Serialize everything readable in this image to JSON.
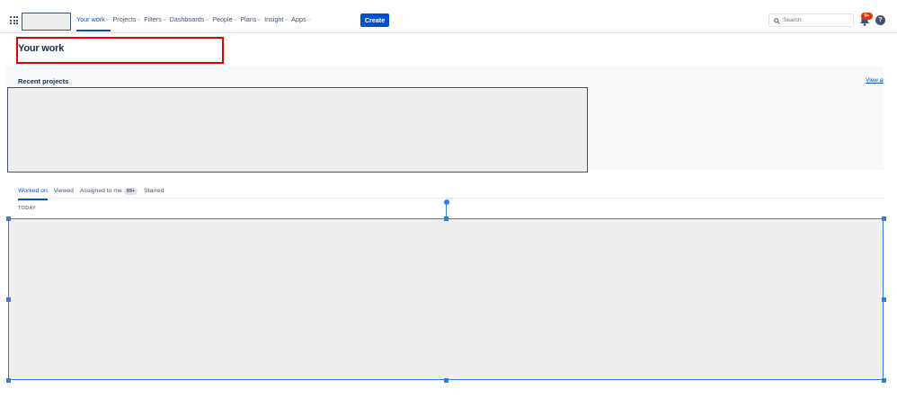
{
  "nav": {
    "your_work": "Your work",
    "projects": "Projects",
    "filters": "Filters",
    "dashboards": "Dashboards",
    "people": "People",
    "plans": "Plans",
    "insight": "Insight",
    "apps": "Apps",
    "create": "Create"
  },
  "search": {
    "placeholder": "Search"
  },
  "notifications": {
    "badge": "9+"
  },
  "help": {
    "label": "?"
  },
  "page": {
    "title": "Your work"
  },
  "recent": {
    "label": "Recent projects",
    "view_all": "View all"
  },
  "tabs": {
    "worked_on": "Worked on",
    "viewed": "Viewed",
    "assigned_to_me": "Assigned to me",
    "assigned_count": "99+",
    "starred": "Starred"
  },
  "list": {
    "group_label": "TODAY"
  },
  "colors": {
    "accent": "#0052cc",
    "highlight": "#e00000",
    "selection": "#2f7de0",
    "badge": "#de350b"
  },
  "icons": [
    "app-switcher-icon",
    "chevron-down-icon",
    "search-icon",
    "bell-icon",
    "help-icon"
  ]
}
